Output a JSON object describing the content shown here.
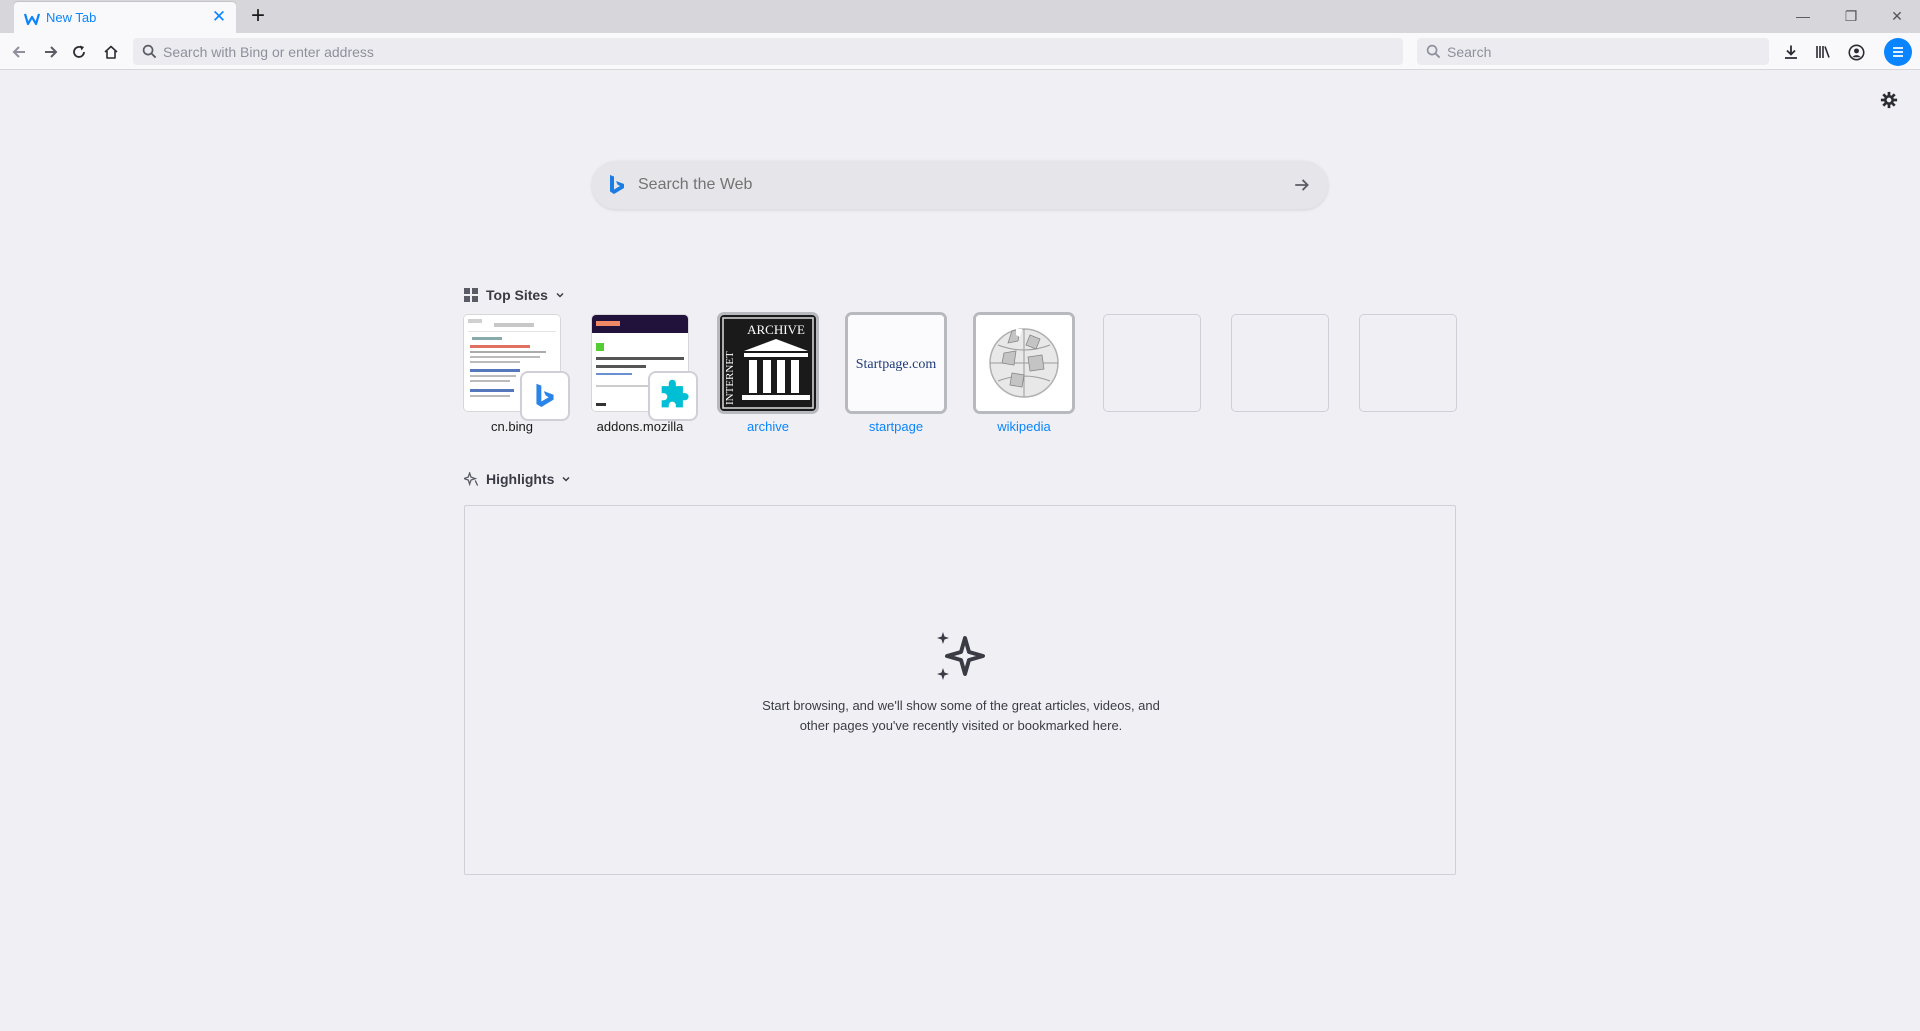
{
  "browser": {
    "tab": {
      "title": "New Tab",
      "close_icon": "close-icon"
    },
    "window_controls": {
      "minimize": "—",
      "restore": "❐",
      "close": "✕"
    },
    "urlbar": {
      "placeholder": "Search with Bing or enter address"
    },
    "searchbar": {
      "placeholder": "Search"
    },
    "accent_color": "#0a84ff"
  },
  "newtab": {
    "websearch": {
      "placeholder": "Search the Web"
    },
    "top_sites": {
      "title": "Top Sites",
      "sites": [
        {
          "label": "cn.bing",
          "kind": "screenshot",
          "badge": "bing-icon"
        },
        {
          "label": "addons.mozilla",
          "kind": "screenshot",
          "badge": "puzzle-icon"
        },
        {
          "label": "archive",
          "kind": "logo",
          "logo_text": "ARCHIVE",
          "logo_side_text": "INTERNET"
        },
        {
          "label": "startpage",
          "kind": "logo",
          "logo_text": "Startpage.com"
        },
        {
          "label": "wikipedia",
          "kind": "logo"
        },
        {
          "label": "",
          "kind": "empty"
        },
        {
          "label": "",
          "kind": "empty"
        },
        {
          "label": "",
          "kind": "empty"
        }
      ]
    },
    "highlights": {
      "title": "Highlights",
      "empty_message": "Start browsing, and we'll show some of the great articles, videos, and other pages you've recently visited or bookmarked here."
    }
  }
}
